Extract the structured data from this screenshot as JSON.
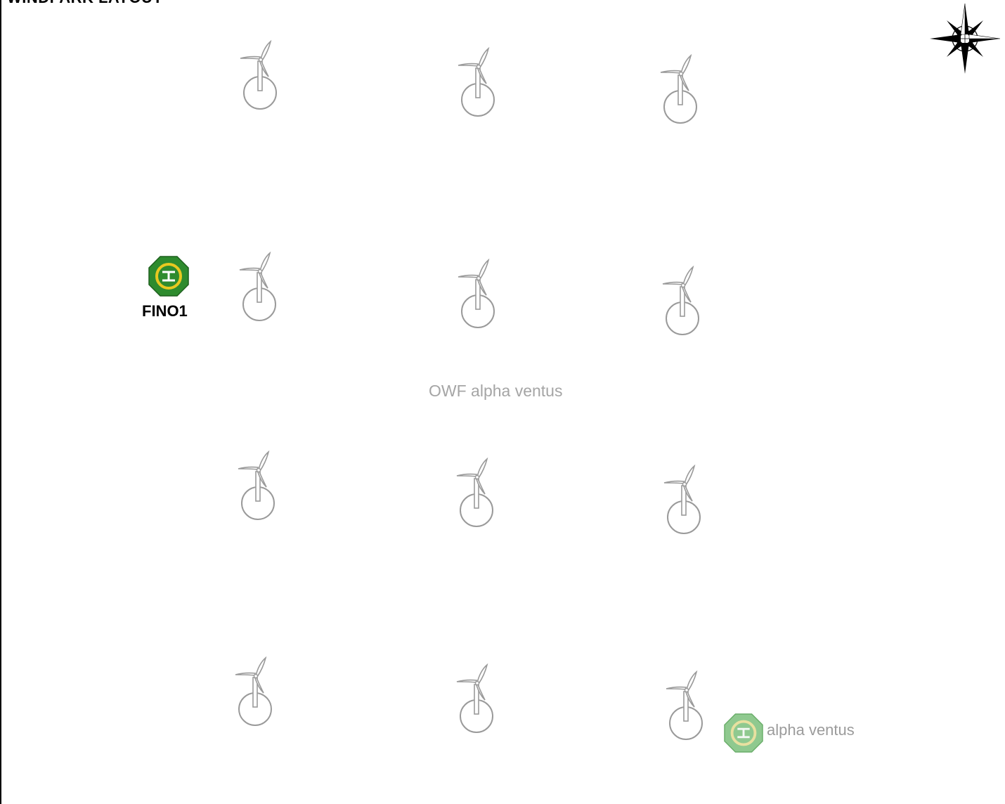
{
  "map": {
    "title": "WINDPARK LAYOUT",
    "area_label": "OWF alpha ventus",
    "compass_icon": "compass-rose-icon",
    "colors": {
      "turbine_stroke": "#9a9a9a",
      "fino_helipad": "#2e8b2e",
      "fino_ring": "#e8c820",
      "alpha_ventus_helipad": "#8fc98f",
      "alpha_ventus_ring": "#e8e0a0"
    }
  },
  "platforms": {
    "fino1": {
      "label": "FINO1",
      "icon": "helipad-icon"
    },
    "alpha_ventus": {
      "label": "alpha ventus",
      "icon": "helipad-icon"
    }
  },
  "turbines": {
    "count": 12,
    "icon": "wind-turbine-icon"
  }
}
